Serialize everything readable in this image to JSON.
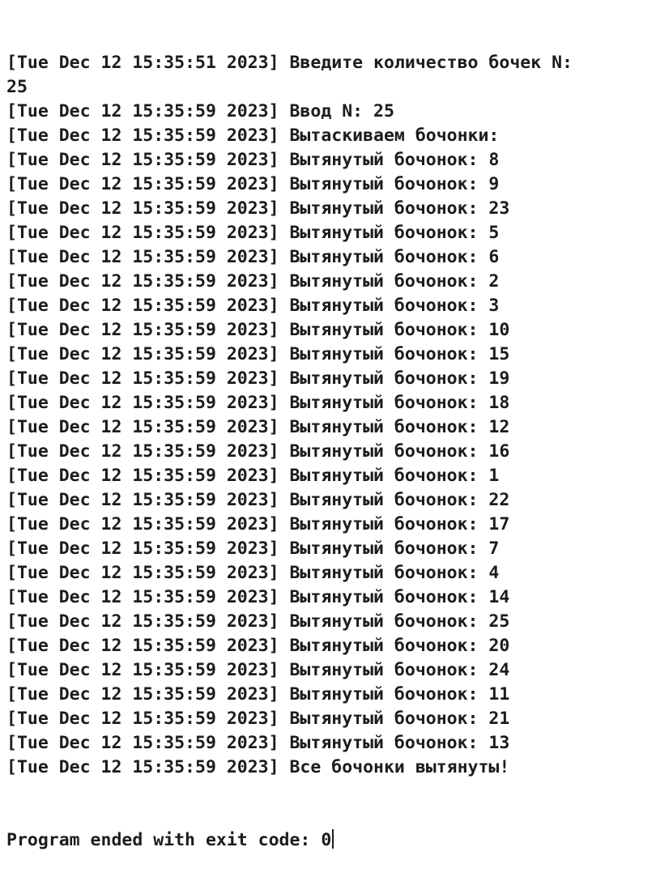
{
  "console": {
    "lines": [
      {
        "timestamp": "[Tue Dec 12 15:35:51 2023]",
        "message": " Введите количество бочек N:"
      },
      {
        "timestamp": "",
        "message": "25"
      },
      {
        "timestamp": "[Tue Dec 12 15:35:59 2023]",
        "message": " Ввод N: 25"
      },
      {
        "timestamp": "[Tue Dec 12 15:35:59 2023]",
        "message": " Вытаскиваем бочонки:"
      },
      {
        "timestamp": "[Tue Dec 12 15:35:59 2023]",
        "message": " Вытянутый бочонок: 8"
      },
      {
        "timestamp": "[Tue Dec 12 15:35:59 2023]",
        "message": " Вытянутый бочонок: 9"
      },
      {
        "timestamp": "[Tue Dec 12 15:35:59 2023]",
        "message": " Вытянутый бочонок: 23"
      },
      {
        "timestamp": "[Tue Dec 12 15:35:59 2023]",
        "message": " Вытянутый бочонок: 5"
      },
      {
        "timestamp": "[Tue Dec 12 15:35:59 2023]",
        "message": " Вытянутый бочонок: 6"
      },
      {
        "timestamp": "[Tue Dec 12 15:35:59 2023]",
        "message": " Вытянутый бочонок: 2"
      },
      {
        "timestamp": "[Tue Dec 12 15:35:59 2023]",
        "message": " Вытянутый бочонок: 3"
      },
      {
        "timestamp": "[Tue Dec 12 15:35:59 2023]",
        "message": " Вытянутый бочонок: 10"
      },
      {
        "timestamp": "[Tue Dec 12 15:35:59 2023]",
        "message": " Вытянутый бочонок: 15"
      },
      {
        "timestamp": "[Tue Dec 12 15:35:59 2023]",
        "message": " Вытянутый бочонок: 19"
      },
      {
        "timestamp": "[Tue Dec 12 15:35:59 2023]",
        "message": " Вытянутый бочонок: 18"
      },
      {
        "timestamp": "[Tue Dec 12 15:35:59 2023]",
        "message": " Вытянутый бочонок: 12"
      },
      {
        "timestamp": "[Tue Dec 12 15:35:59 2023]",
        "message": " Вытянутый бочонок: 16"
      },
      {
        "timestamp": "[Tue Dec 12 15:35:59 2023]",
        "message": " Вытянутый бочонок: 1"
      },
      {
        "timestamp": "[Tue Dec 12 15:35:59 2023]",
        "message": " Вытянутый бочонок: 22"
      },
      {
        "timestamp": "[Tue Dec 12 15:35:59 2023]",
        "message": " Вытянутый бочонок: 17"
      },
      {
        "timestamp": "[Tue Dec 12 15:35:59 2023]",
        "message": " Вытянутый бочонок: 7"
      },
      {
        "timestamp": "[Tue Dec 12 15:35:59 2023]",
        "message": " Вытянутый бочонок: 4"
      },
      {
        "timestamp": "[Tue Dec 12 15:35:59 2023]",
        "message": " Вытянутый бочонок: 14"
      },
      {
        "timestamp": "[Tue Dec 12 15:35:59 2023]",
        "message": " Вытянутый бочонок: 25"
      },
      {
        "timestamp": "[Tue Dec 12 15:35:59 2023]",
        "message": " Вытянутый бочонок: 20"
      },
      {
        "timestamp": "[Tue Dec 12 15:35:59 2023]",
        "message": " Вытянутый бочонок: 24"
      },
      {
        "timestamp": "[Tue Dec 12 15:35:59 2023]",
        "message": " Вытянутый бочонок: 11"
      },
      {
        "timestamp": "[Tue Dec 12 15:35:59 2023]",
        "message": " Вытянутый бочонок: 21"
      },
      {
        "timestamp": "[Tue Dec 12 15:35:59 2023]",
        "message": " Вытянутый бочонок: 13"
      },
      {
        "timestamp": "[Tue Dec 12 15:35:59 2023]",
        "message": " Все бочонки вытянуты!"
      }
    ],
    "exit_message": "Program ended with exit code: 0"
  },
  "colors": {
    "text": "#1c1c1e",
    "background": "#ffffff"
  }
}
